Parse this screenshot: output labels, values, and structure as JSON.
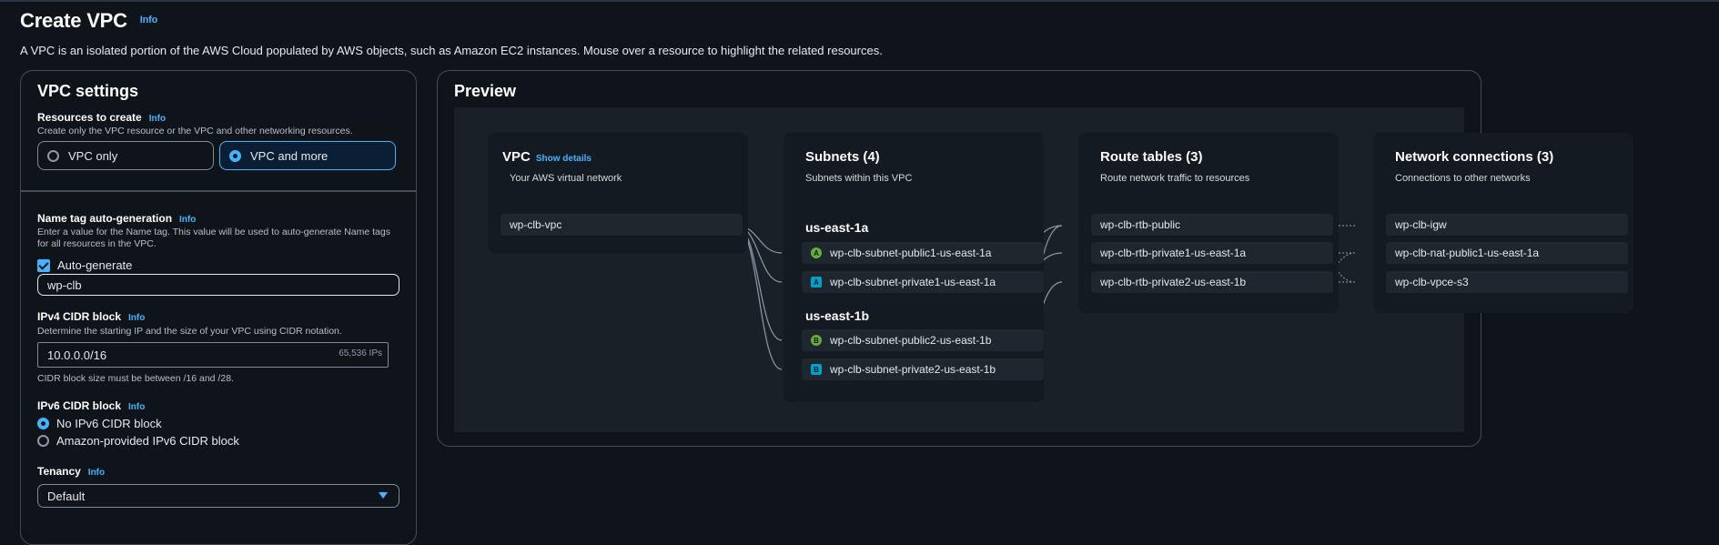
{
  "page": {
    "title": "Create VPC",
    "info": "Info",
    "description": "A VPC is an isolated portion of the AWS Cloud populated by AWS objects, such as Amazon EC2 instances. Mouse over a resource to highlight the related resources."
  },
  "settings": {
    "heading": "VPC settings",
    "resources": {
      "label": "Resources to create",
      "info": "Info",
      "hint": "Create only the VPC resource or the VPC and other networking resources.",
      "options": [
        "VPC only",
        "VPC and more"
      ],
      "selected": "VPC and more"
    },
    "name_tag": {
      "label": "Name tag auto-generation",
      "info": "Info",
      "hint": "Enter a value for the Name tag. This value will be used to auto-generate Name tags for all resources in the VPC.",
      "checkbox_label": "Auto-generate",
      "checked": true,
      "value": "wp-clb"
    },
    "ipv4": {
      "label": "IPv4 CIDR block",
      "info": "Info",
      "hint": "Determine the starting IP and the size of your VPC using CIDR notation.",
      "value": "10.0.0.0/16",
      "suffix": "65,536 IPs",
      "constraint": "CIDR block size must be between /16 and /28."
    },
    "ipv6": {
      "label": "IPv6 CIDR block",
      "info": "Info",
      "options": [
        "No IPv6 CIDR block",
        "Amazon-provided IPv6 CIDR block"
      ],
      "selected": "No IPv6 CIDR block"
    },
    "tenancy": {
      "label": "Tenancy",
      "info": "Info",
      "value": "Default"
    }
  },
  "preview": {
    "heading": "Preview",
    "vpc": {
      "title": "VPC",
      "link": "Show details",
      "subtitle": "Your AWS virtual network",
      "name": "wp-clb-vpc"
    },
    "subnets": {
      "title": "Subnets (4)",
      "subtitle": "Subnets within this VPC",
      "zones": [
        {
          "name": "us-east-1a",
          "items": [
            {
              "badge": "A",
              "type": "public",
              "name": "wp-clb-subnet-public1-us-east-1a"
            },
            {
              "badge": "A",
              "type": "private",
              "name": "wp-clb-subnet-private1-us-east-1a"
            }
          ]
        },
        {
          "name": "us-east-1b",
          "items": [
            {
              "badge": "B",
              "type": "public",
              "name": "wp-clb-subnet-public2-us-east-1b"
            },
            {
              "badge": "B",
              "type": "private",
              "name": "wp-clb-subnet-private2-us-east-1b"
            }
          ]
        }
      ]
    },
    "route_tables": {
      "title": "Route tables (3)",
      "subtitle": "Route network traffic to resources",
      "items": [
        "wp-clb-rtb-public",
        "wp-clb-rtb-private1-us-east-1a",
        "wp-clb-rtb-private2-us-east-1b"
      ]
    },
    "network": {
      "title": "Network connections (3)",
      "subtitle": "Connections to other networks",
      "items": [
        "wp-clb-igw",
        "wp-clb-nat-public1-us-east-1a",
        "wp-clb-vpce-s3"
      ]
    }
  },
  "colors": {
    "accent": "#42b4ff",
    "public_subnet": "#69ae34",
    "private_subnet": "#00a1c9"
  }
}
